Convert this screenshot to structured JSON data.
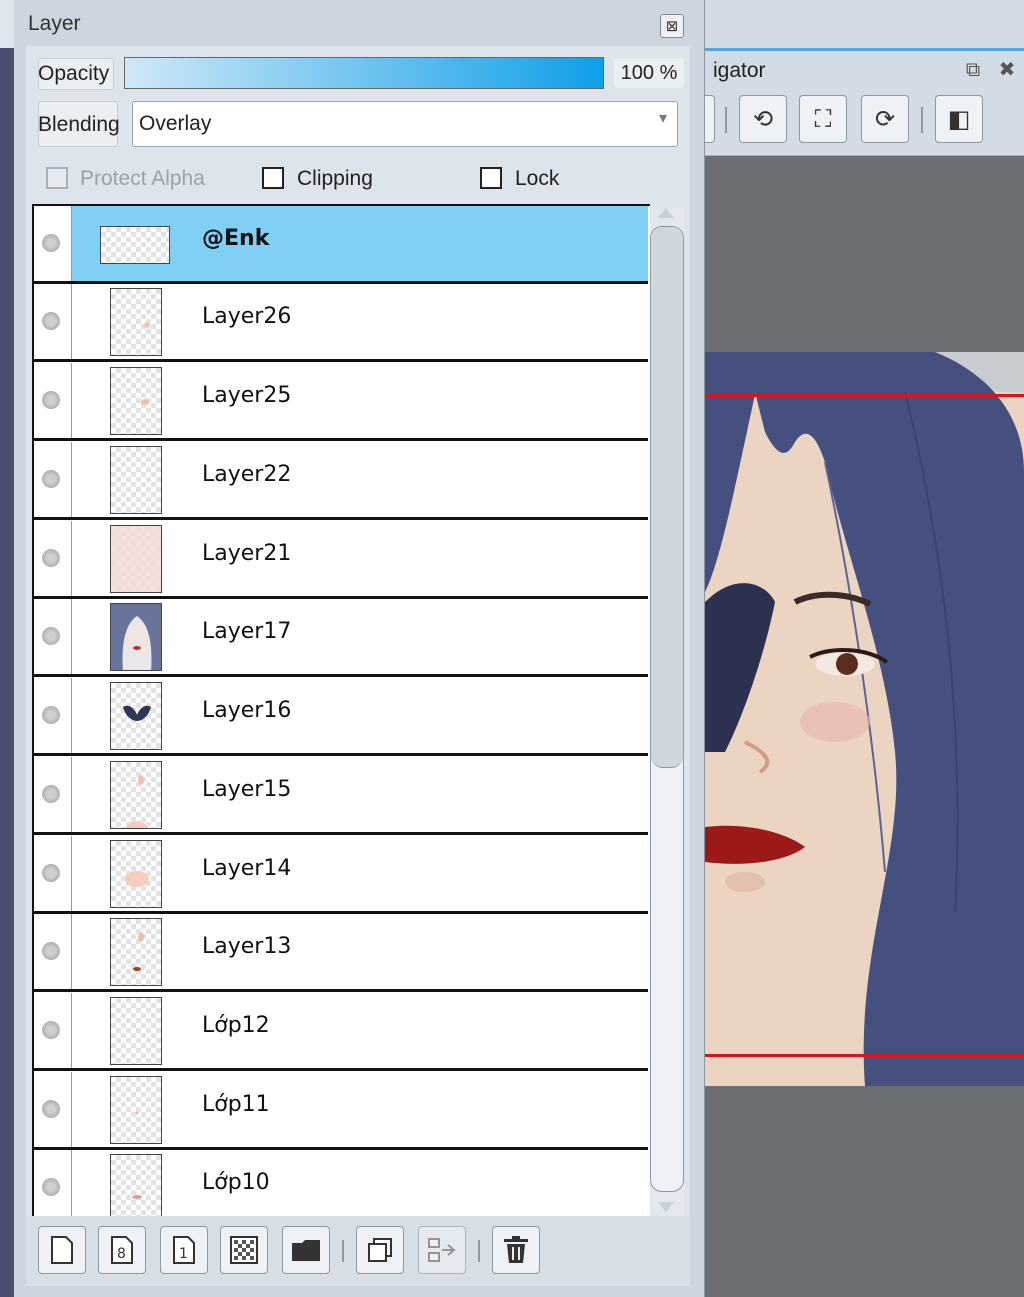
{
  "layer_panel": {
    "title": "Layer",
    "close_icon": "close-icon",
    "opacity": {
      "label": "Opacity",
      "value": "100 %",
      "percent": 100
    },
    "blending": {
      "label": "Blending",
      "value": "Overlay"
    },
    "checks": {
      "protect_alpha": "Protect Alpha",
      "clipping": "Clipping",
      "lock": "Lock"
    },
    "layers": [
      {
        "name": "@Enk",
        "selected": true
      },
      {
        "name": "Layer26"
      },
      {
        "name": "Layer25"
      },
      {
        "name": "Layer22"
      },
      {
        "name": "Layer21"
      },
      {
        "name": "Layer17"
      },
      {
        "name": "Layer16"
      },
      {
        "name": "Layer15"
      },
      {
        "name": "Layer14"
      },
      {
        "name": "Layer13"
      },
      {
        "name": "Lớp12"
      },
      {
        "name": "Lớp11"
      },
      {
        "name": "Lớp10"
      }
    ],
    "bottom_tools": [
      "new-layer-icon",
      "new-8bit-layer-icon",
      "new-1bit-layer-icon",
      "new-halftone-layer-icon",
      "new-folder-icon",
      "duplicate-layer-icon",
      "merge-down-icon",
      "delete-layer-icon"
    ]
  },
  "navigator": {
    "title": "igator",
    "tools": [
      "rotate-left-icon",
      "fit-window-icon",
      "rotate-right-icon",
      "flip-horizontal-icon"
    ],
    "colors": {
      "hair": "#46507e",
      "skin": "#ecd3c1",
      "lips": "#9c1a18",
      "border_red": "#d9141c"
    }
  }
}
